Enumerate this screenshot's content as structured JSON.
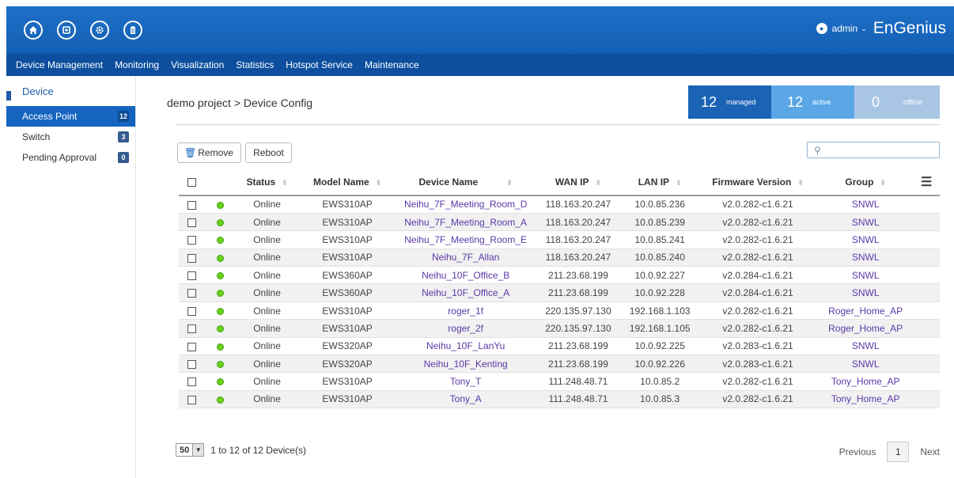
{
  "header": {
    "icons": [
      "home-icon",
      "dashboard-icon",
      "gear-icon",
      "clipboard-icon"
    ],
    "username": "admin",
    "brand": "EnGenius"
  },
  "nav": {
    "items": [
      "Device Management",
      "Monitoring",
      "Visualization",
      "Statistics",
      "Hotspot Service",
      "Maintenance"
    ]
  },
  "sidebar": {
    "section": "Device",
    "items": [
      {
        "label": "Access Point",
        "count": "12"
      },
      {
        "label": "Switch",
        "count": "3"
      },
      {
        "label": "Pending Approval",
        "count": "0"
      }
    ]
  },
  "breadcrumb": "demo project > Device Config",
  "stats": {
    "managed": {
      "num": "12",
      "label": "managed"
    },
    "active": {
      "num": "12",
      "label": "active"
    },
    "offline": {
      "num": "0",
      "label": "offline"
    }
  },
  "toolbar": {
    "remove_label": "Remove",
    "reboot_label": "Reboot",
    "search_placeholder": ""
  },
  "table": {
    "headers": [
      "Status",
      "Model Name",
      "Device Name",
      "WAN IP",
      "LAN IP",
      "Firmware Version",
      "Group"
    ],
    "rows": [
      {
        "status": "Online",
        "model": "EWS310AP",
        "name": "Neihu_7F_Meeting_Room_D",
        "wan": "118.163.20.247",
        "lan": "10.0.85.236",
        "fw": "v2.0.282-c1.6.21",
        "group": "SNWL"
      },
      {
        "status": "Online",
        "model": "EWS310AP",
        "name": "Neihu_7F_Meeting_Room_A",
        "wan": "118.163.20.247",
        "lan": "10.0.85.239",
        "fw": "v2.0.282-c1.6.21",
        "group": "SNWL"
      },
      {
        "status": "Online",
        "model": "EWS310AP",
        "name": "Neihu_7F_Meeting_Room_E",
        "wan": "118.163.20.247",
        "lan": "10.0.85.241",
        "fw": "v2.0.282-c1.6.21",
        "group": "SNWL"
      },
      {
        "status": "Online",
        "model": "EWS310AP",
        "name": "Neihu_7F_Allan",
        "wan": "118.163.20.247",
        "lan": "10.0.85.240",
        "fw": "v2.0.282-c1.6.21",
        "group": "SNWL"
      },
      {
        "status": "Online",
        "model": "EWS360AP",
        "name": "Neihu_10F_Office_B",
        "wan": "211.23.68.199",
        "lan": "10.0.92.227",
        "fw": "v2.0.284-c1.6.21",
        "group": "SNWL"
      },
      {
        "status": "Online",
        "model": "EWS360AP",
        "name": "Neihu_10F_Office_A",
        "wan": "211.23.68.199",
        "lan": "10.0.92.228",
        "fw": "v2.0.284-c1.6.21",
        "group": "SNWL"
      },
      {
        "status": "Online",
        "model": "EWS310AP",
        "name": "roger_1f",
        "wan": "220.135.97.130",
        "lan": "192.168.1.103",
        "fw": "v2.0.282-c1.6.21",
        "group": "Roger_Home_AP"
      },
      {
        "status": "Online",
        "model": "EWS310AP",
        "name": "roger_2f",
        "wan": "220.135.97.130",
        "lan": "192.168.1.105",
        "fw": "v2.0.282-c1.6.21",
        "group": "Roger_Home_AP"
      },
      {
        "status": "Online",
        "model": "EWS320AP",
        "name": "Neihu_10F_LanYu",
        "wan": "211.23.68.199",
        "lan": "10.0.92.225",
        "fw": "v2.0.283-c1.6.21",
        "group": "SNWL"
      },
      {
        "status": "Online",
        "model": "EWS320AP",
        "name": "Neihu_10F_Kenting",
        "wan": "211.23.68.199",
        "lan": "10.0.92.226",
        "fw": "v2.0.283-c1.6.21",
        "group": "SNWL"
      },
      {
        "status": "Online",
        "model": "EWS310AP",
        "name": "Tony_T",
        "wan": "111.248.48.71",
        "lan": "10.0.85.2",
        "fw": "v2.0.282-c1.6.21",
        "group": "Tony_Home_AP"
      },
      {
        "status": "Online",
        "model": "EWS310AP",
        "name": "Tony_A",
        "wan": "111.248.48.71",
        "lan": "10.0.85.3",
        "fw": "v2.0.282-c1.6.21",
        "group": "Tony_Home_AP"
      }
    ]
  },
  "pagination": {
    "page_size": "50",
    "summary": "1 to 12 of 12 Device(s)",
    "previous": "Previous",
    "current_page": "1",
    "next": "Next"
  },
  "colors": {
    "header_blue": "#1565c0",
    "nav_blue": "#0d4f9e",
    "online_green": "#6bd11c",
    "link_purple": "#5a38a8"
  }
}
